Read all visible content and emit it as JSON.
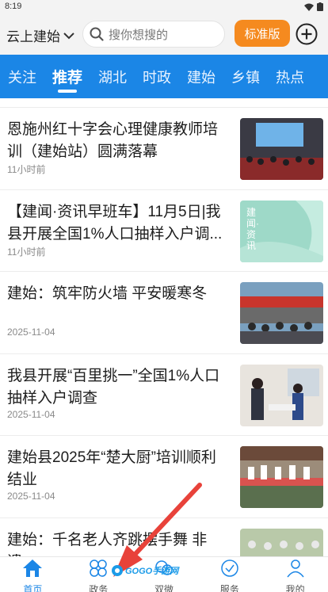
{
  "status_bar": {
    "time": "8:19"
  },
  "top_bar": {
    "location": "云上建始",
    "search_placeholder": "搜你想搜的",
    "edition_button": "标准版"
  },
  "channels": [
    {
      "label": "关注",
      "active": false
    },
    {
      "label": "推荐",
      "active": true
    },
    {
      "label": "湖北",
      "active": false
    },
    {
      "label": "时政",
      "active": false
    },
    {
      "label": "建始",
      "active": false
    },
    {
      "label": "乡镇",
      "active": false
    },
    {
      "label": "热点",
      "active": false
    }
  ],
  "articles": [
    {
      "title": "恩施州红十字会心理健康教师培训（建始站）圆满落幕",
      "time": "11小时前",
      "thumb": "training-classroom-photo"
    },
    {
      "title": "【建闻·资讯早班车】11月5日|我县开展全国1%人口抽样入户调...",
      "time": "11小时前",
      "thumb": "news-brand-banner",
      "thumb_text": "建闻·资讯"
    },
    {
      "title": "建始：筑牢防火墙 平安暖寒冬",
      "time": "2025-11-04",
      "thumb": "fire-safety-gathering-photo"
    },
    {
      "title": "我县开展“百里挑一”全国1%人口抽样入户调查",
      "time": "2025-11-04",
      "thumb": "household-survey-photo"
    },
    {
      "title": "建始县2025年“楚大厨”培训顺利结业",
      "time": "2025-11-04",
      "thumb": "chef-training-photo"
    },
    {
      "title": "建始：千名老人齐跳摆手舞 非遗...",
      "time": "",
      "thumb": "elderly-dance-photo"
    }
  ],
  "bottom_nav": [
    {
      "label": "首页",
      "icon": "home-icon",
      "active": true
    },
    {
      "label": "政务",
      "icon": "government-icon",
      "active": false
    },
    {
      "label": "双微",
      "icon": "social-icon",
      "active": false
    },
    {
      "label": "服务",
      "icon": "service-icon",
      "active": false
    },
    {
      "label": "我的",
      "icon": "profile-icon",
      "active": false
    }
  ],
  "watermark": {
    "text": "GOGO手游网"
  },
  "colors": {
    "brand_blue": "#1b86e6",
    "edition_orange": "#f58a1f",
    "arrow_red": "#e8423a"
  }
}
